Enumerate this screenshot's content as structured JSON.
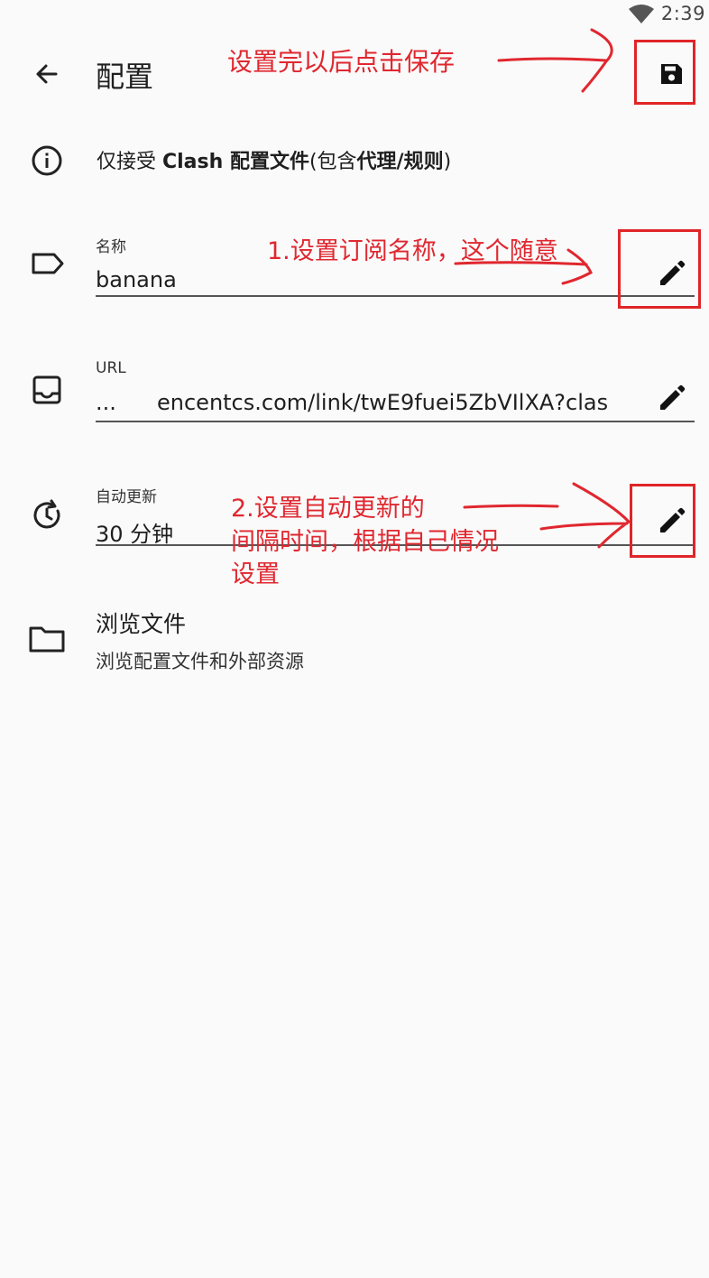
{
  "status_bar": {
    "time": "2:39",
    "wifi_icon": "wifi-icon"
  },
  "app_bar": {
    "back_icon": "arrow-back-icon",
    "title": "配置",
    "save_icon": "save-icon"
  },
  "notice": {
    "icon": "info-icon",
    "prefix": "仅接受 ",
    "bold1": "Clash 配置文件",
    "middle": "(包含",
    "bold2": "代理/规则",
    "suffix": ")"
  },
  "name_field": {
    "icon": "label-tag-icon",
    "label": "名称",
    "value": "banana",
    "edit_icon": "pencil-icon"
  },
  "url_field": {
    "icon": "inbox-icon",
    "label": "URL",
    "ellipsis": "...",
    "value": "encentcs.com/link/twE9fuei5ZbVIlXA?clas",
    "edit_icon": "pencil-icon"
  },
  "update_field": {
    "icon": "history-icon",
    "label": "自动更新",
    "value": "30 分钟",
    "edit_icon": "pencil-icon"
  },
  "browse": {
    "icon": "folder-icon",
    "title": "浏览文件",
    "subtitle": "浏览配置文件和外部资源"
  },
  "annotations": {
    "save_note": "设置完以后点击保存",
    "name_note": "1.设置订阅名称，这个随意",
    "update_note_line1": "2.设置自动更新的",
    "update_note_line2": "间隔时间，根据自己情况",
    "update_note_line3": "设置",
    "accent_color": "#e0272f"
  },
  "colors": {
    "background": "#fafafa",
    "text": "#1f1f1f",
    "annotation": "#e0272f"
  }
}
